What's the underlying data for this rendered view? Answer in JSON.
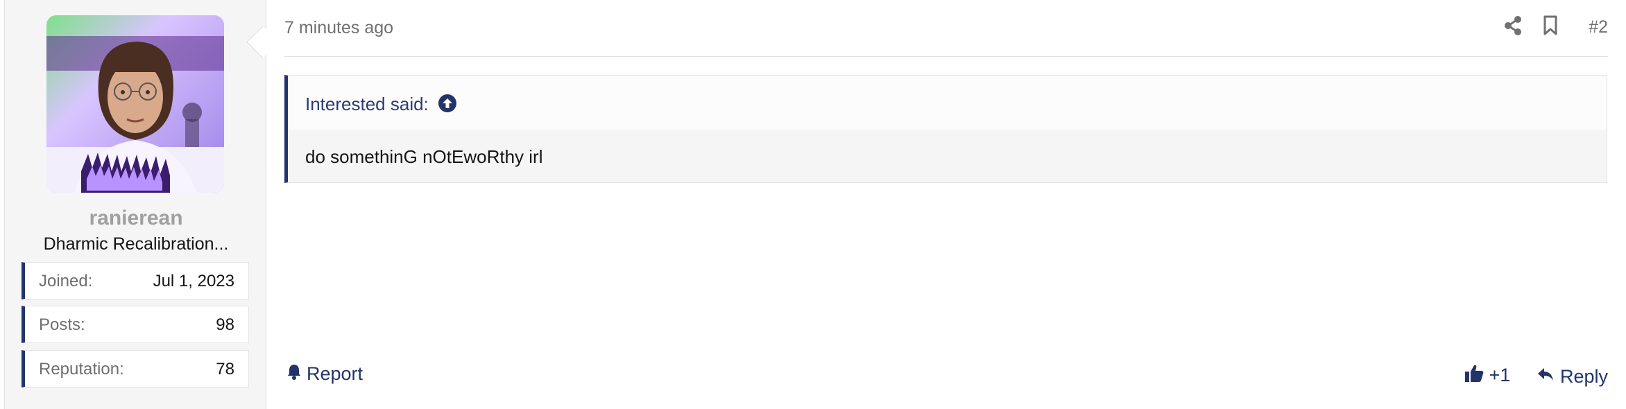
{
  "author": {
    "username": "ranierean",
    "user_title": "Dharmic Recalibration...",
    "stats": [
      {
        "label": "Joined:",
        "value": "Jul 1, 2023"
      },
      {
        "label": "Posts:",
        "value": "98"
      },
      {
        "label": "Reputation:",
        "value": "78"
      }
    ]
  },
  "post": {
    "time": "7 minutes ago",
    "number": "#2",
    "quote": {
      "author_label": "Interested said:",
      "text": "do somethinG nOtEwoRthy irl"
    }
  },
  "footer": {
    "report_label": "Report",
    "like_label": "+1",
    "reply_label": "Reply"
  },
  "icons": {
    "share": "share-icon",
    "bookmark": "bookmark-icon",
    "quote_up": "arrow-up-circle-icon",
    "report": "bell-icon",
    "like": "thumbs-up-icon",
    "reply": "reply-icon"
  },
  "colors": {
    "accent": "#23346b",
    "link": "#2b3a74",
    "muted": "#707070"
  }
}
